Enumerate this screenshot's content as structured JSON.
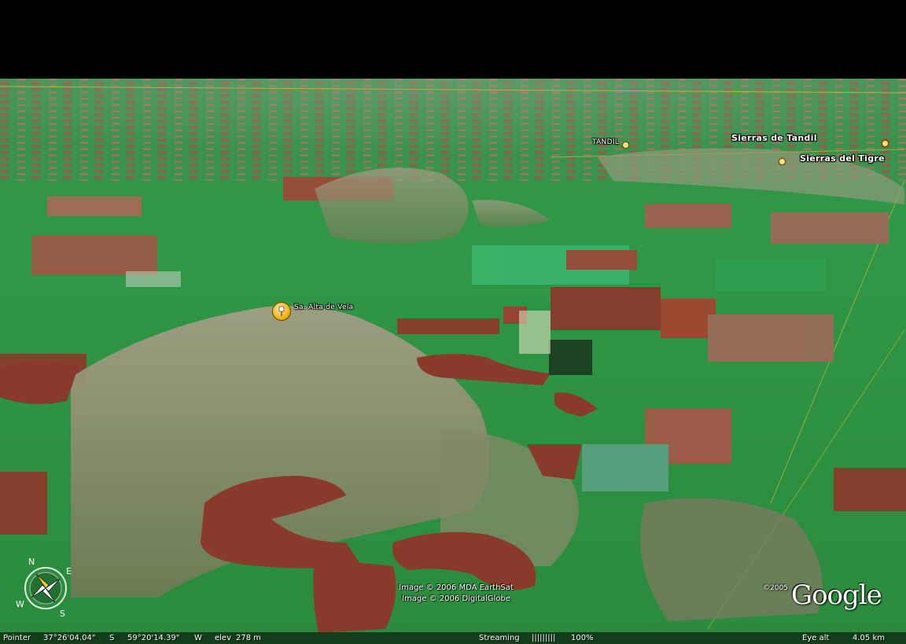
{
  "placemarks": {
    "tandil": "TANDIL",
    "sierras_tandil": "Sierras de Tandil",
    "sierras_tigre": "Sierras del Tigre",
    "alta_vela": "Sa. Alta de Vela"
  },
  "attribution": {
    "line1": "Image © 2006 MDA EarthSat",
    "line2": "Image © 2006 DigitalGlobe"
  },
  "logo": {
    "copyright": "©2005",
    "name": "Google"
  },
  "compass": {
    "n": "N",
    "e": "E",
    "s": "S",
    "w": "W"
  },
  "status": {
    "pointer_label": "Pointer",
    "lat": "37°26'04.04\"",
    "lat_hemi": "S",
    "lon": "59°20'14.39\"",
    "lon_hemi": "W",
    "elev_label": "elev",
    "elev_value": "278 m",
    "streaming_label": "Streaming",
    "streaming_bar": "|||||||||",
    "streaming_pct": "100%",
    "eye_label": "Eye  alt",
    "eye_value": "4.05 km"
  },
  "colors": {
    "sky": "#000000",
    "field_green": "#2e9a45",
    "field_red": "#8a3a2a",
    "ridge": "#8f8a72",
    "road": "#e0c030"
  }
}
